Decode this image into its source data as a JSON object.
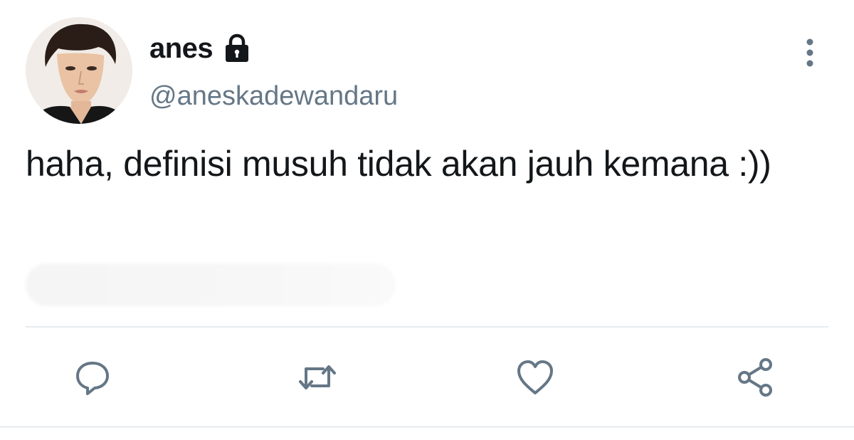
{
  "tweet": {
    "display_name": "anes",
    "handle": "@aneskadewandaru",
    "text": "haha, definisi musuh tidak akan jauh kemana :))",
    "protected_account_icon": "lock-icon",
    "more_options_icon": "vertical-ellipsis-icon"
  },
  "actions": [
    {
      "name": "reply",
      "icon": "comment-icon"
    },
    {
      "name": "retweet",
      "icon": "retweet-icon"
    },
    {
      "name": "like",
      "icon": "heart-icon"
    },
    {
      "name": "share",
      "icon": "share-icon"
    }
  ],
  "colors": {
    "text_primary": "#14171a",
    "text_secondary": "#657786",
    "icon_gray": "#657786",
    "divider": "#e6ecf0"
  }
}
